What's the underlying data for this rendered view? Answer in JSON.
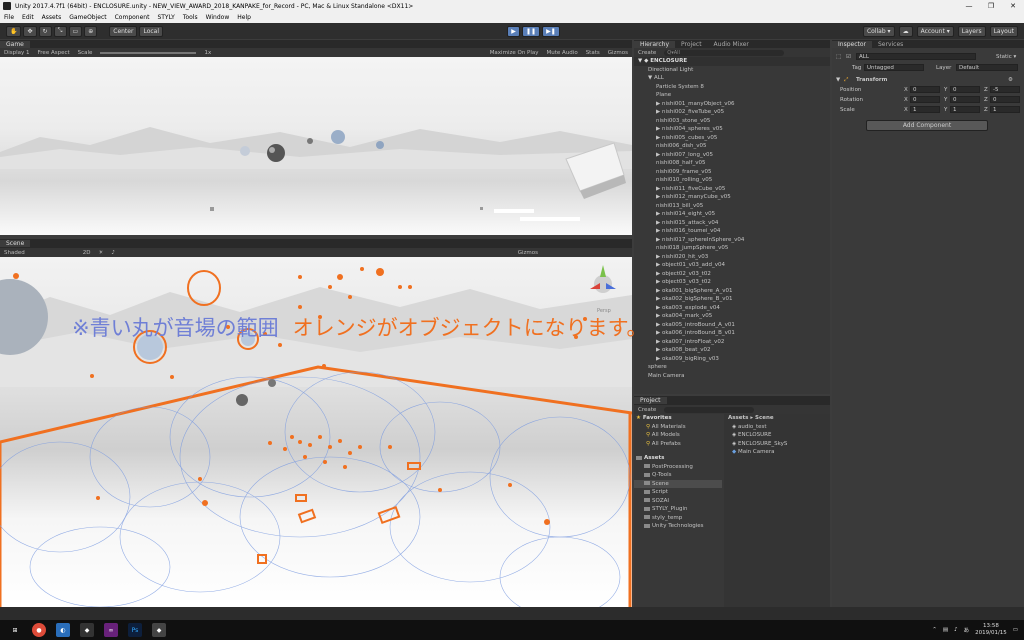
{
  "window": {
    "title": "Unity 2017.4.7f1 (64bit) - ENCLOSURE.unity - NEW_VIEW_AWARD_2018_KANPAKE_for_Record - PC, Mac & Linux Standalone <DX11>",
    "minimize": "—",
    "maximize": "❐",
    "close": "✕"
  },
  "menu": [
    "File",
    "Edit",
    "Assets",
    "GameObject",
    "Component",
    "STYLY",
    "Tools",
    "Window",
    "Help"
  ],
  "toolbar": {
    "pivot": "Center",
    "space": "Local",
    "collab": "Collab ▾",
    "account": "Account ▾",
    "layers": "Layers",
    "layout": "Layout"
  },
  "game": {
    "tab": "Game",
    "display": "Display 1",
    "aspect": "Free Aspect",
    "scale_label": "Scale",
    "scale_value": "1x",
    "maximize": "Maximize On Play",
    "mute": "Mute Audio",
    "stats": "Stats",
    "gizmos": "Gizmos"
  },
  "scene": {
    "tab": "Scene",
    "shaded": "Shaded",
    "mode2d": "2D",
    "gizmos": "Gizmos",
    "persp": "Persp"
  },
  "caption": {
    "blue": "※青い丸が音場の範囲",
    "orange": "オレンジがオブジェクトになります。"
  },
  "hierarchy": {
    "tab": "Hierarchy",
    "tab2": "Project",
    "tab3": "Audio Mixer",
    "create": "Create",
    "search_placeholder": "Q▾All",
    "root": "ENCLOSURE",
    "items": [
      {
        "label": "Directional Light",
        "indent": 1
      },
      {
        "label": "▼ ALL",
        "indent": 1
      },
      {
        "label": "Particle System 8",
        "indent": 2
      },
      {
        "label": "Plane",
        "indent": 2
      },
      {
        "label": "▶ nishi001_manyObject_v06",
        "indent": 2
      },
      {
        "label": "▶ nishi002_fiveTube_v05",
        "indent": 2
      },
      {
        "label": "nishi003_stone_v05",
        "indent": 2
      },
      {
        "label": "▶ nishi004_spheres_v05",
        "indent": 2
      },
      {
        "label": "▶ nishi005_cubes_v05",
        "indent": 2
      },
      {
        "label": "nishi006_dish_v05",
        "indent": 2
      },
      {
        "label": "▶ nishi007_long_v05",
        "indent": 2
      },
      {
        "label": "nishi008_half_v05",
        "indent": 2
      },
      {
        "label": "nishi009_frame_v05",
        "indent": 2
      },
      {
        "label": "nishi010_rolling_v05",
        "indent": 2
      },
      {
        "label": "▶ nishi011_fiveCube_v05",
        "indent": 2
      },
      {
        "label": "▶ nishi012_manyCube_v05",
        "indent": 2
      },
      {
        "label": "nishi013_bill_v05",
        "indent": 2
      },
      {
        "label": "▶ nishi014_eight_v05",
        "indent": 2
      },
      {
        "label": "▶ nishi015_attack_v04",
        "indent": 2
      },
      {
        "label": "▶ nishi016_toumei_v04",
        "indent": 2
      },
      {
        "label": "▶ nishi017_sphereInSphere_v04",
        "indent": 2
      },
      {
        "label": "nishi018_jumpSphere_v05",
        "indent": 2
      },
      {
        "label": "▶ nishi020_hit_v03",
        "indent": 2
      },
      {
        "label": "▶ object01_v03_add_v04",
        "indent": 2
      },
      {
        "label": "▶ object02_v03_t02",
        "indent": 2
      },
      {
        "label": "▶ object03_v03_t02",
        "indent": 2
      },
      {
        "label": "▶ oka001_bigSphere_A_v01",
        "indent": 2
      },
      {
        "label": "▶ oka002_bigSphere_B_v01",
        "indent": 2
      },
      {
        "label": "▶ oka003_explode_v04",
        "indent": 2
      },
      {
        "label": "▶ oka004_mark_v05",
        "indent": 2
      },
      {
        "label": "▶ oka005_introBound_A_v01",
        "indent": 2
      },
      {
        "label": "▶ oka006_introBound_B_v01",
        "indent": 2
      },
      {
        "label": "▶ oka007_introFloat_v02",
        "indent": 2
      },
      {
        "label": "▶ oka008_beat_v02",
        "indent": 2
      },
      {
        "label": "▶ oka009_bigRing_v03",
        "indent": 2
      },
      {
        "label": "sphere",
        "indent": 1
      },
      {
        "label": "Main Camera",
        "indent": 1
      }
    ]
  },
  "project": {
    "tab": "Project",
    "create": "Create",
    "favorites": "Favorites",
    "fav_items": [
      "All Materials",
      "All Models",
      "All Prefabs"
    ],
    "assets": "Assets",
    "folders": [
      "PostProcessing",
      "Q-Tools",
      "Scene",
      "Script",
      "SOZAI",
      "STYLY_Plugin",
      "styly_temp",
      "Unity Technologies"
    ],
    "breadcrumb": "Assets ▸ Scene",
    "files": [
      "audio_test",
      "ENCLOSURE",
      "ENCLOSURE_SkyS",
      "Main Camera"
    ]
  },
  "inspector": {
    "tab": "Inspector",
    "tab2": "Services",
    "object_name": "ALL",
    "static": "Static ▾",
    "tag_label": "Tag",
    "tag_value": "Untagged",
    "layer_label": "Layer",
    "layer_value": "Default",
    "transform": "Transform",
    "position_label": "Position",
    "rotation_label": "Rotation",
    "scale_label": "Scale",
    "position": {
      "x": "0",
      "y": "0",
      "z": "-5"
    },
    "rotation": {
      "x": "0",
      "y": "0",
      "z": "0"
    },
    "scale": {
      "x": "1",
      "y": "1",
      "z": "1"
    },
    "add_component": "Add Component"
  },
  "taskbar": {
    "time": "13:58",
    "date": "2019/01/15"
  },
  "colors": {
    "orange": "#f07020",
    "blue": "#6f7fd6",
    "panel": "#383838"
  }
}
